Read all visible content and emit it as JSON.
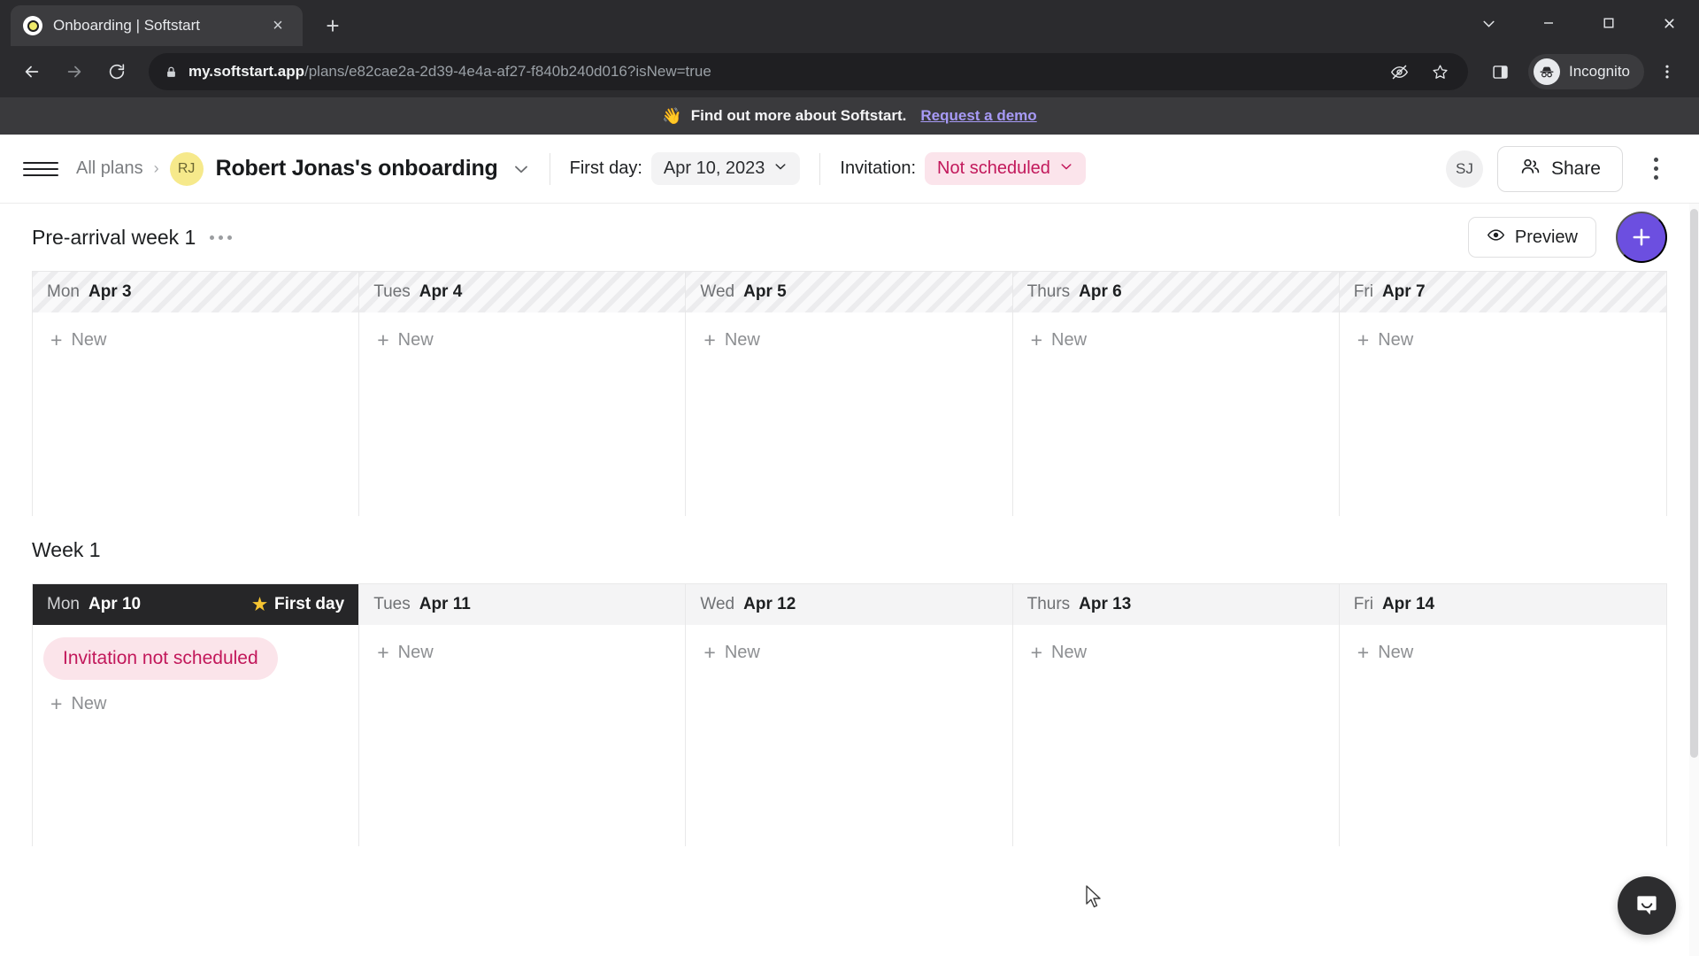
{
  "browser": {
    "tab": {
      "title": "Onboarding | Softstart",
      "favicon": "softstart-dot-icon",
      "close": "×"
    },
    "new_tab_label": "+",
    "window": {
      "minimize": "–",
      "maximize": "□",
      "close": "✕",
      "dropdown": "⌄"
    },
    "url": {
      "domain": "my.softstart.app",
      "path": "/plans/e82cae2a-2d39-4e4a-af27-f840b240d016?isNew=true"
    },
    "profile_label": "Incognito",
    "icons": {
      "back": "back-arrow-icon",
      "forward": "forward-arrow-icon",
      "reload": "reload-icon",
      "lock": "lock-icon",
      "tracking_blocked": "eye-slash-icon",
      "bookmark": "star-icon",
      "side_panel": "side-panel-icon",
      "incognito": "incognito-hat-icon",
      "menu": "kebab-menu-icon"
    }
  },
  "promo": {
    "emoji": "👋",
    "text": "Find out more about Softstart.",
    "link": "Request a demo"
  },
  "header": {
    "breadcrumb_root": "All plans",
    "separator": "›",
    "plan_avatar_initials": "RJ",
    "plan_title": "Robert Jonas's onboarding",
    "first_day_label": "First day:",
    "first_day_value": "Apr 10, 2023",
    "invitation_label": "Invitation:",
    "invitation_value": "Not scheduled",
    "user_avatar_initials": "SJ",
    "share_label": "Share"
  },
  "colors": {
    "accent_purple": "#6c4fe0",
    "invitation_pink_bg": "#fbe4ea",
    "invitation_pink_text": "#c2185b",
    "avatar_yellow": "#f6e98b",
    "first_day_bar": "#262628",
    "star_gold": "#f5c432",
    "promo_link": "#a79af6"
  },
  "sections": [
    {
      "title": "Pre-arrival week 1",
      "has_menu": true,
      "preview_label": "Preview",
      "add_label": "+",
      "days": [
        {
          "dow": "Mon",
          "date": "Apr 3",
          "style": "hatched",
          "first_day": false,
          "new_label": "New",
          "cards": []
        },
        {
          "dow": "Tues",
          "date": "Apr 4",
          "style": "hatched",
          "first_day": false,
          "new_label": "New",
          "cards": []
        },
        {
          "dow": "Wed",
          "date": "Apr 5",
          "style": "hatched",
          "first_day": false,
          "new_label": "New",
          "cards": []
        },
        {
          "dow": "Thurs",
          "date": "Apr 6",
          "style": "hatched",
          "first_day": false,
          "new_label": "New",
          "cards": []
        },
        {
          "dow": "Fri",
          "date": "Apr 7",
          "style": "hatched",
          "first_day": false,
          "new_label": "New",
          "cards": []
        }
      ]
    },
    {
      "title": "Week 1",
      "has_menu": false,
      "days": [
        {
          "dow": "Mon",
          "date": "Apr 10",
          "style": "first",
          "first_day": true,
          "first_day_label": "First day",
          "new_label": "New",
          "cards": [
            "Invitation not scheduled"
          ]
        },
        {
          "dow": "Tues",
          "date": "Apr 11",
          "style": "plain",
          "first_day": false,
          "new_label": "New",
          "cards": []
        },
        {
          "dow": "Wed",
          "date": "Apr 12",
          "style": "plain",
          "first_day": false,
          "new_label": "New",
          "cards": []
        },
        {
          "dow": "Thurs",
          "date": "Apr 13",
          "style": "plain",
          "first_day": false,
          "new_label": "New",
          "cards": []
        },
        {
          "dow": "Fri",
          "date": "Apr 14",
          "style": "plain",
          "first_day": false,
          "new_label": "New",
          "cards": []
        }
      ]
    }
  ],
  "chat_widget": {
    "icon": "chat-bubble-smile-icon"
  }
}
